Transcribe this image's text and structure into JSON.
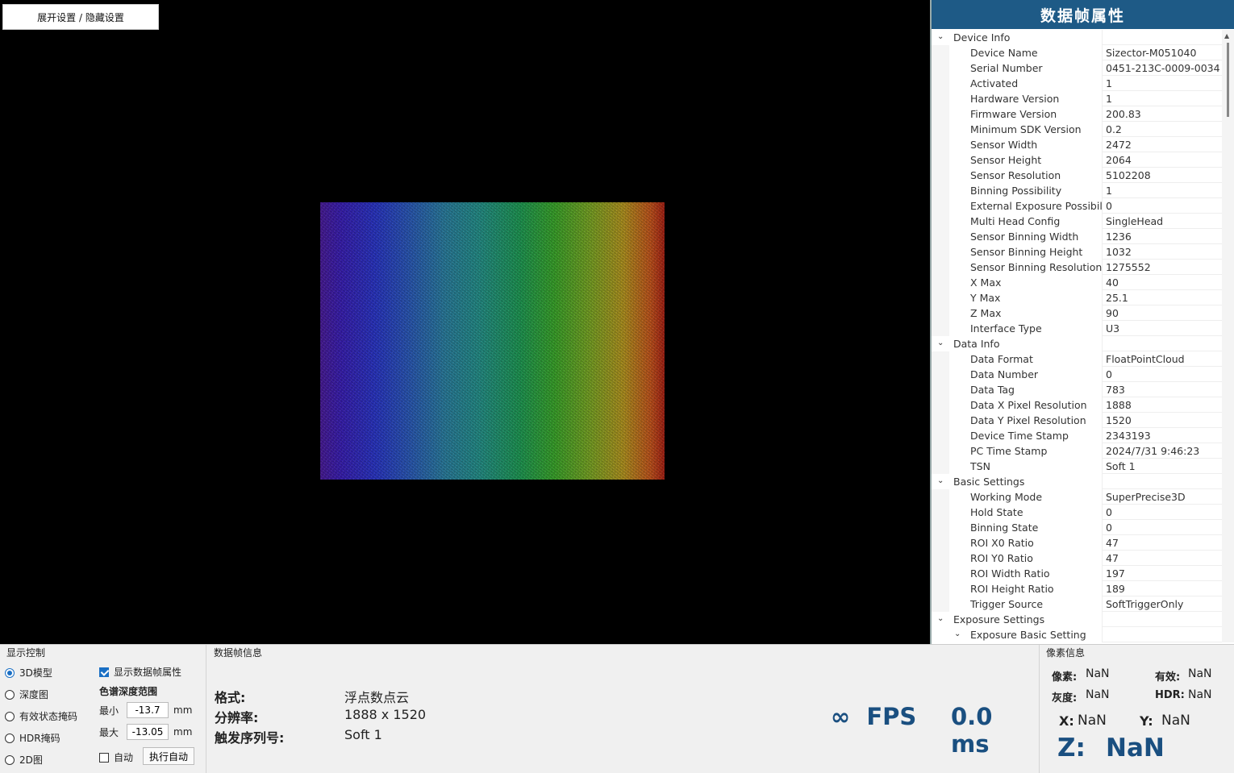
{
  "viewport": {
    "toggle_button": "展开设置 / 隐藏设置"
  },
  "props_panel": {
    "title": "数据帧属性",
    "rows": [
      {
        "type": "group",
        "name": "Device Info",
        "value": ""
      },
      {
        "type": "item",
        "name": "Device Name",
        "value": "Sizector-M051040"
      },
      {
        "type": "item",
        "name": "Serial Number",
        "value": "0451-213C-0009-0034"
      },
      {
        "type": "item",
        "name": "Activated",
        "value": "1"
      },
      {
        "type": "item",
        "name": "Hardware Version",
        "value": "1"
      },
      {
        "type": "item",
        "name": "Firmware Version",
        "value": "200.83"
      },
      {
        "type": "item",
        "name": "Minimum SDK Version",
        "value": "0.2"
      },
      {
        "type": "item",
        "name": "Sensor Width",
        "value": "2472"
      },
      {
        "type": "item",
        "name": "Sensor Height",
        "value": "2064"
      },
      {
        "type": "item",
        "name": "Sensor Resolution",
        "value": "5102208"
      },
      {
        "type": "item",
        "name": "Binning Possibility",
        "value": "1"
      },
      {
        "type": "item",
        "name": "External Exposure Possibility",
        "value": "0"
      },
      {
        "type": "item",
        "name": "Multi Head Config",
        "value": "SingleHead"
      },
      {
        "type": "item",
        "name": "Sensor Binning Width",
        "value": "1236"
      },
      {
        "type": "item",
        "name": "Sensor Binning Height",
        "value": "1032"
      },
      {
        "type": "item",
        "name": "Sensor Binning Resolution",
        "value": "1275552"
      },
      {
        "type": "item",
        "name": "X Max",
        "value": "40"
      },
      {
        "type": "item",
        "name": "Y Max",
        "value": "25.1"
      },
      {
        "type": "item",
        "name": "Z Max",
        "value": "90"
      },
      {
        "type": "item",
        "name": "Interface Type",
        "value": "U3"
      },
      {
        "type": "group",
        "name": "Data Info",
        "value": ""
      },
      {
        "type": "item",
        "name": "Data Format",
        "value": "FloatPointCloud"
      },
      {
        "type": "item",
        "name": "Data Number",
        "value": "0"
      },
      {
        "type": "item",
        "name": "Data Tag",
        "value": "783"
      },
      {
        "type": "item",
        "name": "Data X Pixel Resolution",
        "value": "1888"
      },
      {
        "type": "item",
        "name": "Data Y Pixel Resolution",
        "value": "1520"
      },
      {
        "type": "item",
        "name": "Device Time Stamp",
        "value": "2343193"
      },
      {
        "type": "item",
        "name": "PC Time Stamp",
        "value": "2024/7/31 9:46:23"
      },
      {
        "type": "item",
        "name": "TSN",
        "value": "Soft 1"
      },
      {
        "type": "group",
        "name": "Basic Settings",
        "value": ""
      },
      {
        "type": "item",
        "name": "Working Mode",
        "value": "SuperPrecise3D"
      },
      {
        "type": "item",
        "name": "Hold State",
        "value": "0"
      },
      {
        "type": "item",
        "name": "Binning State",
        "value": "0"
      },
      {
        "type": "item",
        "name": "ROI X0 Ratio",
        "value": "47"
      },
      {
        "type": "item",
        "name": "ROI Y0 Ratio",
        "value": "47"
      },
      {
        "type": "item",
        "name": "ROI Width Ratio",
        "value": "197"
      },
      {
        "type": "item",
        "name": "ROI Height Ratio",
        "value": "189"
      },
      {
        "type": "item",
        "name": "Trigger Source",
        "value": "SoftTriggerOnly"
      },
      {
        "type": "group",
        "name": "Exposure Settings",
        "value": ""
      },
      {
        "type": "subgroup",
        "name": "Exposure Basic Setting",
        "value": ""
      }
    ]
  },
  "display_control": {
    "title": "显示控制",
    "modes": [
      "3D模型",
      "深度图",
      "有效状态掩码",
      "HDR掩码",
      "2D图"
    ],
    "selected_mode": "3D模型",
    "show_props_label": "显示数据帧属性",
    "show_props_checked": true,
    "color_range_title": "色谱深度范围",
    "min_label": "最小",
    "min_value": "-13.7",
    "max_label": "最大",
    "max_value": "-13.05",
    "unit": "mm",
    "auto_label": "自动",
    "auto_checked": false,
    "run_auto_label": "执行自动"
  },
  "frame_info": {
    "title": "数据帧信息",
    "format_label": "格式:",
    "format_value": "浮点数点云",
    "resolution_label": "分辨率:",
    "resolution_value": "1888 x 1520",
    "tsn_label": "触发序列号:",
    "tsn_value": "Soft 1",
    "fps": "∞  FPS",
    "ms": "0.0 ms"
  },
  "pixel_info": {
    "title": "像素信息",
    "pixel_label": "像素:",
    "pixel_value": "NaN",
    "valid_label": "有效:",
    "valid_value": "NaN",
    "gray_label": "灰度:",
    "gray_value": "NaN",
    "hdr_label": "HDR:",
    "hdr_value": "NaN",
    "x_label": "X:",
    "x_value": "NaN",
    "y_label": "Y:",
    "y_value": "NaN",
    "z_label": "Z:",
    "z_value": "NaN"
  },
  "colors": {
    "header_bg": "#1e5a86",
    "accent": "#1a4f80",
    "check_blue": "#1a6fc4"
  }
}
